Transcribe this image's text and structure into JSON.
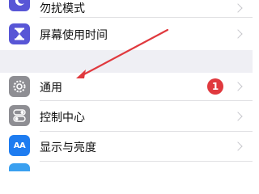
{
  "settings": {
    "items": [
      {
        "label": "勿扰模式",
        "icon": "moon-icon",
        "color": "#5856d6"
      },
      {
        "label": "屏幕使用时间",
        "icon": "hourglass-icon",
        "color": "#5856d6"
      },
      {
        "label": "通用",
        "icon": "gear-icon",
        "color": "#8e8e93",
        "badge": "1"
      },
      {
        "label": "控制中心",
        "icon": "toggles-icon",
        "color": "#8e8e93"
      },
      {
        "label": "显示与亮度",
        "icon": "text-size-icon",
        "color": "#1e7cf0",
        "icon_text": "AA"
      }
    ]
  },
  "badge_color": "#e0393e",
  "annotation_color": "#e0393e"
}
